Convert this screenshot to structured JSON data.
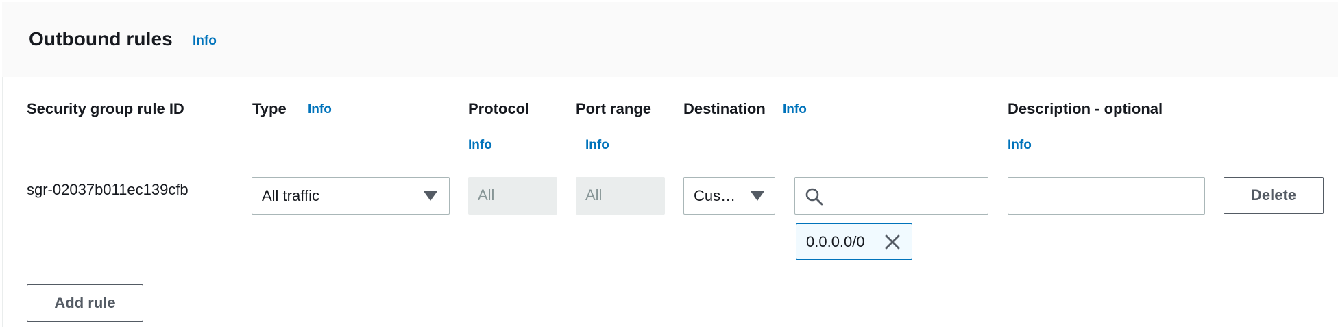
{
  "section": {
    "title": "Outbound rules",
    "info_label": "Info"
  },
  "columns": {
    "rule_id": "Security group rule ID",
    "type": "Type",
    "protocol": "Protocol",
    "port_range": "Port range",
    "destination": "Destination",
    "description": "Description - optional",
    "info_label": "Info"
  },
  "rule": {
    "id": "sgr-02037b011ec139cfb",
    "type_value": "All traffic",
    "protocol_value": "All",
    "port_range_value": "All",
    "destination_type": "Cus…",
    "destination_search_value": "",
    "destination_token": "0.0.0.0/0",
    "description_value": "",
    "delete_label": "Delete"
  },
  "actions": {
    "add_rule_label": "Add rule"
  },
  "icons": {
    "type_caret": "caret-down-icon",
    "destination_caret": "caret-down-icon",
    "search": "search-icon",
    "remove_token": "close-icon"
  },
  "colors": {
    "link": "#0073bb",
    "text": "#16191f",
    "border": "#aab7b8",
    "disabled_bg": "#eaeded",
    "token_border": "#0073bb",
    "token_bg": "#f1faff"
  }
}
